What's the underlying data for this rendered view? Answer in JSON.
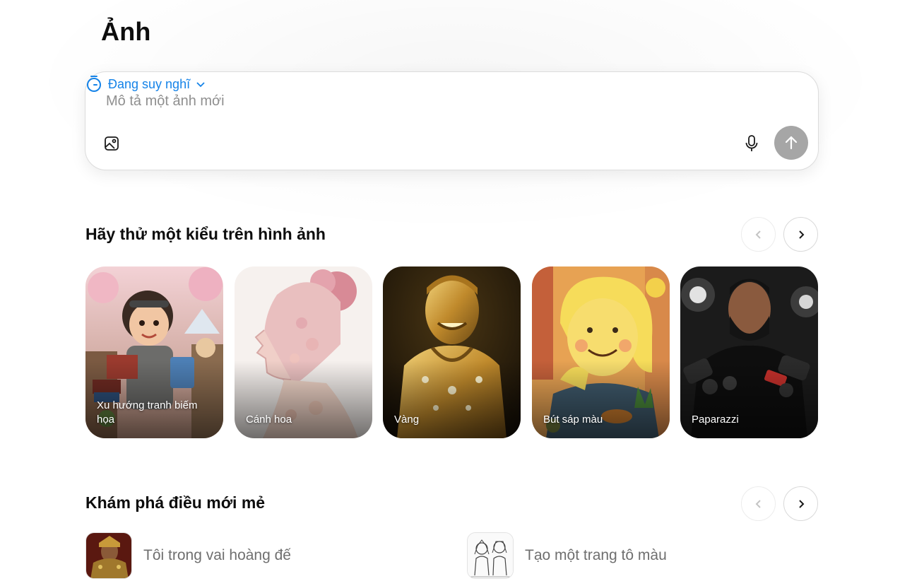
{
  "page": {
    "title": "Ảnh"
  },
  "composer": {
    "placeholder": "Mô tả một ảnh mới",
    "mode_label": "Đang suy nghĩ",
    "accent_color": "#1583e8",
    "send_color": "#a6a6a6"
  },
  "styles_section": {
    "title": "Hãy thử một kiểu trên hình ảnh",
    "cards": [
      {
        "label": "Xu hướng tranh biếm họa",
        "icon": "cartoon-collage-image"
      },
      {
        "label": "Cánh hoa",
        "icon": "petal-portrait-image"
      },
      {
        "label": "Vàng",
        "icon": "gold-statue-image"
      },
      {
        "label": "Bút sáp màu",
        "icon": "crayon-drawing-image"
      },
      {
        "label": "Paparazzi",
        "icon": "paparazzi-photo-image"
      }
    ]
  },
  "explore_section": {
    "title": "Khám phá điều mới mẻ",
    "items": [
      {
        "label": "Tôi trong vai hoàng đế",
        "icon": "emperor-portrait-image"
      },
      {
        "label": "Tạo một trang tô màu",
        "icon": "coloring-page-image"
      }
    ]
  }
}
